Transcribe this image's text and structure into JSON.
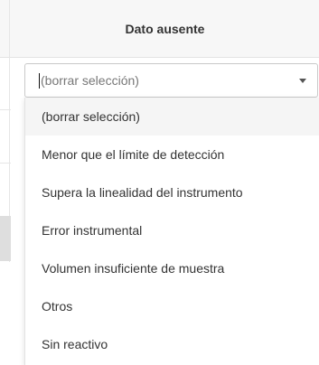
{
  "table": {
    "column_header": "Dato ausente"
  },
  "select": {
    "current_text": "(borrar selección)"
  },
  "dropdown": {
    "options": [
      "(borrar selección)",
      "Menor que el límite de detección",
      "Supera la linealidad del instrumento",
      "Error instrumental",
      "Volumen insuficiente de muestra",
      "Otros",
      "Sin reactivo"
    ]
  },
  "icons": {
    "dropdown_arrow": "chevron-down-icon"
  }
}
